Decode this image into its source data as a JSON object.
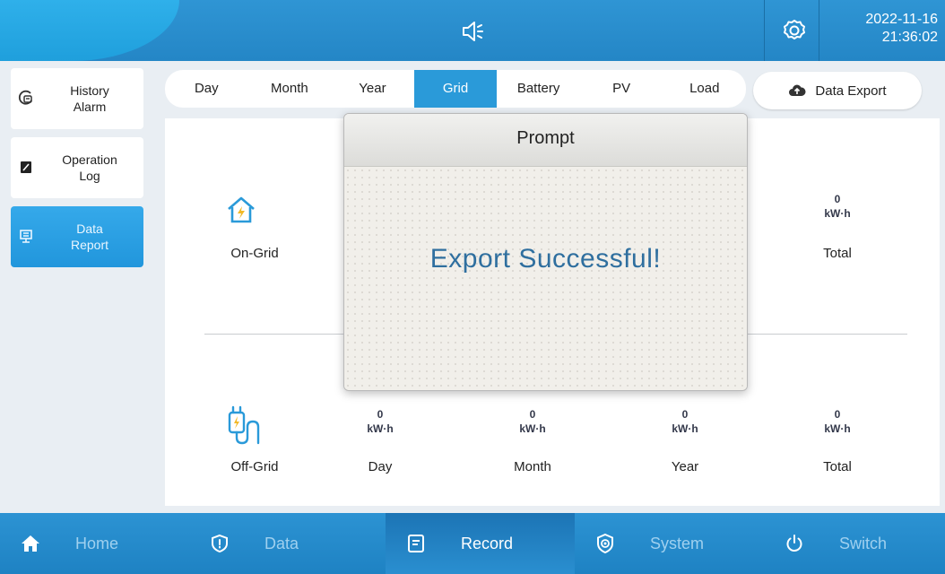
{
  "header": {
    "date": "2022-11-16",
    "time": "21:36:02",
    "speaker_icon": "speaker-icon",
    "settings_icon": "gear-icon"
  },
  "sidebar": {
    "items": [
      {
        "label": "History\nAlarm",
        "icon": "history-alarm-icon",
        "active": false
      },
      {
        "label": "Operation\nLog",
        "icon": "log-icon",
        "active": false
      },
      {
        "label": "Data\nReport",
        "icon": "report-icon",
        "active": true
      }
    ]
  },
  "tabs": {
    "items": [
      "Day",
      "Month",
      "Year",
      "Grid",
      "Battery",
      "PV",
      "Load"
    ],
    "active": "Grid"
  },
  "export_button": {
    "label": "Data Export",
    "icon": "upload-cloud-icon"
  },
  "report": {
    "on_grid": {
      "title": "On-Grid",
      "icon": "house-bolt-icon",
      "total": {
        "value": "0",
        "unit": "kW·h",
        "label": "Total"
      }
    },
    "off_grid": {
      "title": "Off-Grid",
      "icon": "plug-icon",
      "cells": [
        {
          "value": "0",
          "unit": "kW·h",
          "label": "Day"
        },
        {
          "value": "0",
          "unit": "kW·h",
          "label": "Month"
        },
        {
          "value": "0",
          "unit": "kW·h",
          "label": "Year"
        },
        {
          "value": "0",
          "unit": "kW·h",
          "label": "Total"
        }
      ]
    }
  },
  "modal": {
    "title": "Prompt",
    "message": "Export Successful!"
  },
  "bottom_nav": {
    "items": [
      {
        "label": "Home",
        "icon": "home-icon"
      },
      {
        "label": "Data",
        "icon": "shield-icon"
      },
      {
        "label": "Record",
        "icon": "record-icon"
      },
      {
        "label": "System",
        "icon": "system-icon"
      },
      {
        "label": "Switch",
        "icon": "power-icon"
      }
    ],
    "active": "Record"
  },
  "colors": {
    "accent": "#2a9ad9",
    "topbar": "#2486c6",
    "message": "#2f6f9f"
  }
}
